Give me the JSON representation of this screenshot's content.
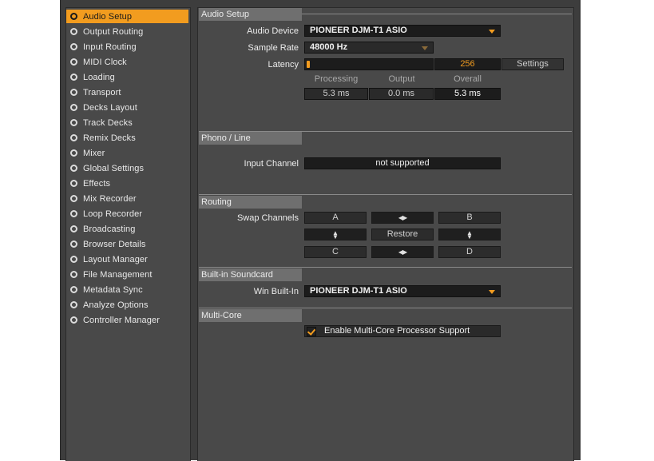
{
  "sidebar": {
    "items": [
      {
        "label": "Audio Setup",
        "active": true
      },
      {
        "label": "Output Routing"
      },
      {
        "label": "Input Routing"
      },
      {
        "label": "MIDI Clock"
      },
      {
        "label": "Loading"
      },
      {
        "label": "Transport"
      },
      {
        "label": "Decks Layout"
      },
      {
        "label": "Track Decks"
      },
      {
        "label": "Remix Decks"
      },
      {
        "label": "Mixer"
      },
      {
        "label": "Global Settings"
      },
      {
        "label": "Effects"
      },
      {
        "label": "Mix Recorder"
      },
      {
        "label": "Loop Recorder"
      },
      {
        "label": "Broadcasting"
      },
      {
        "label": "Browser Details"
      },
      {
        "label": "Layout Manager"
      },
      {
        "label": "File Management"
      },
      {
        "label": "Metadata Sync"
      },
      {
        "label": "Analyze Options"
      },
      {
        "label": "Controller Manager"
      }
    ]
  },
  "audio_setup": {
    "title": "Audio Setup",
    "audio_device_label": "Audio Device",
    "audio_device_value": "PIONEER DJM-T1 ASIO",
    "sample_rate_label": "Sample Rate",
    "sample_rate_value": "48000 Hz",
    "latency_label": "Latency",
    "latency_value": "256",
    "latency_slider_fraction": 0.02,
    "settings_button": "Settings",
    "processing_label": "Processing",
    "output_label": "Output",
    "overall_label": "Overall",
    "processing_value": "5.3 ms",
    "output_value": "0.0 ms",
    "overall_value": "5.3 ms"
  },
  "phono_line": {
    "title": "Phono / Line",
    "input_channel_label": "Input Channel",
    "input_channel_value": "not supported"
  },
  "routing": {
    "title": "Routing",
    "swap_channels_label": "Swap Channels",
    "channel_a": "A",
    "channel_b": "B",
    "channel_c": "C",
    "channel_d": "D",
    "restore_button": "Restore"
  },
  "builtin_soundcard": {
    "title": "Built-in Soundcard",
    "win_builtin_label": "Win Built-In",
    "win_builtin_value": "PIONEER DJM-T1 ASIO"
  },
  "multi_core": {
    "title": "Multi-Core",
    "enable_label": "Enable Multi-Core Processor Support",
    "enabled": true
  },
  "colors": {
    "accent": "#f29c1f",
    "panel_bg": "#494949",
    "field_bg": "#1c1c1c"
  }
}
